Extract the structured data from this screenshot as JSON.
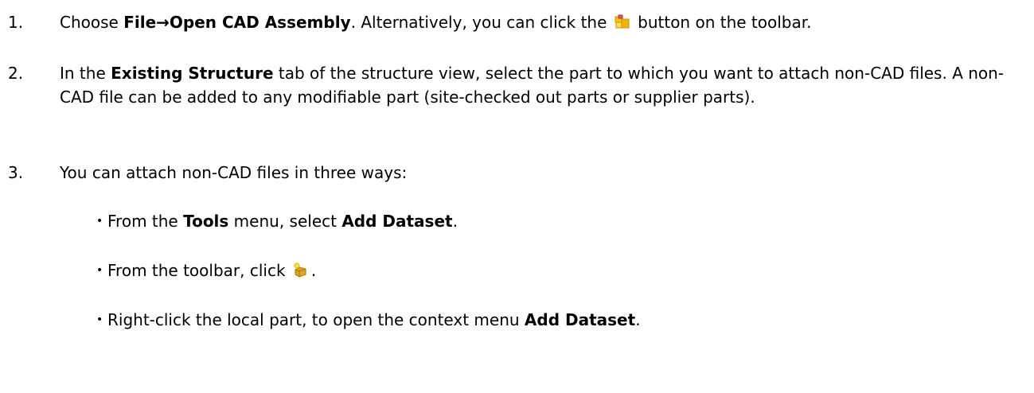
{
  "steps": [
    {
      "number": "1.",
      "choose": "Choose ",
      "menu_path": "File→Open CAD Assembly",
      "alt_prefix": ". Alternatively, you can click the ",
      "icon": "open-cad-assembly-icon",
      "alt_suffix": " button on the toolbar."
    },
    {
      "number": "2.",
      "in_the": "In the ",
      "tab_name": "Existing Structure",
      "text": " tab of the structure view, select the part to which you want to attach non-CAD files. A non-CAD file can be added to any modifiable part (site-checked out parts or supplier parts)."
    },
    {
      "number": "3.",
      "text": "You can attach non-CAD files in three ways:"
    }
  ],
  "bullets": [
    {
      "marker": "•",
      "prefix": "From the ",
      "menu": "Tools",
      "middle": " menu, select ",
      "command": "Add Dataset",
      "suffix": "."
    },
    {
      "marker": "•",
      "prefix": "From the toolbar, click ",
      "icon": "add-dataset-icon",
      "suffix": "."
    },
    {
      "marker": "•",
      "prefix": "Right-click the local part, to open the context menu ",
      "command": "Add Dataset",
      "suffix": "."
    }
  ]
}
